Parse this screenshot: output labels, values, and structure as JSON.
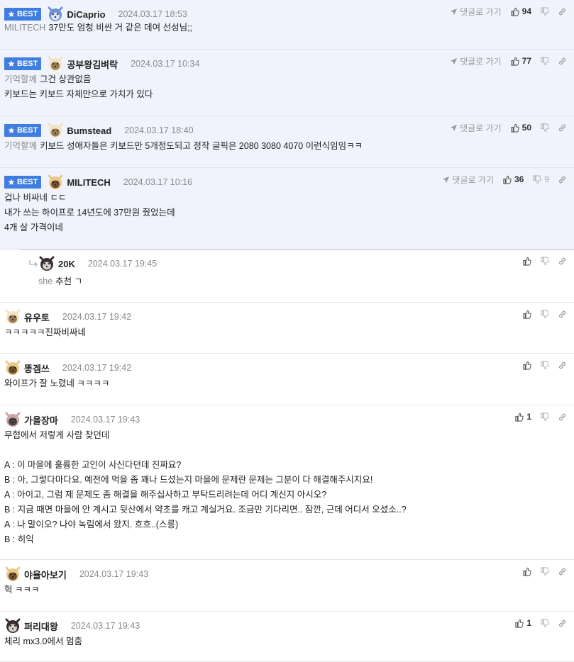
{
  "comments": [
    {
      "best": true,
      "badge": "BEST",
      "nick": "DiCaprio",
      "date": "2024.03.17 18:53",
      "reply_link": "댓글로 가기",
      "likes": "94",
      "dislikes": "",
      "lines": [
        {
          "ref": "MILITECH",
          "text": "37만도 엄청 비싼 거 같은 데여 선성님;;"
        }
      ]
    },
    {
      "best": true,
      "badge": "BEST",
      "nick": "공부왕김벼락",
      "date": "2024.03.17 10:34",
      "reply_link": "댓글로 가기",
      "likes": "77",
      "dislikes": "",
      "lines": [
        {
          "ref": "기억할께",
          "text": "그건 상관없음"
        },
        {
          "ref": "",
          "text": "키보드는 키보드 자체만으로 가치가 있다"
        }
      ]
    },
    {
      "best": true,
      "badge": "BEST",
      "nick": "Bumstead",
      "date": "2024.03.17 18:40",
      "reply_link": "댓글로 가기",
      "likes": "50",
      "dislikes": "",
      "lines": [
        {
          "ref": "기억할께",
          "text": "키보드 성애자들은 키보드만 5개정도되고 정작 글픽은 2080 3080 4070 이런식임임ㅋㅋ"
        }
      ]
    },
    {
      "best": true,
      "badge": "BEST",
      "nick": "MILITECH",
      "date": "2024.03.17 10:16",
      "reply_link": "댓글로 가기",
      "likes": "36",
      "dislikes": "9",
      "lines": [
        {
          "ref": "",
          "text": "겁나 비싸네 ㄷㄷ"
        },
        {
          "ref": "",
          "text": "내가 쓰는 하이프로 14년도에 37만원 줬었는데"
        },
        {
          "ref": "",
          "text": "4개 살 가격이네"
        }
      ]
    },
    {
      "best": false,
      "reply": true,
      "nick": "20K",
      "date": "2024.03.17 19:45",
      "likes": "",
      "dislikes": "",
      "lines": [
        {
          "ref": "she",
          "text": "추천 ㄱ"
        }
      ]
    },
    {
      "best": false,
      "nick": "유우토",
      "date": "2024.03.17 19:42",
      "likes": "",
      "dislikes": "",
      "lines": [
        {
          "ref": "",
          "text": "ㅋㅋㅋㅋㅋ진짜비싸네"
        }
      ]
    },
    {
      "best": false,
      "nick": "똥겜쓰",
      "date": "2024.03.17 19:42",
      "likes": "",
      "dislikes": "",
      "lines": [
        {
          "ref": "",
          "text": "와이프가 잘 노렸네 ㅋㅋㅋㅋ"
        }
      ]
    },
    {
      "best": false,
      "nick": "가을장마",
      "date": "2024.03.17 19:43",
      "likes": "1",
      "dislikes": "",
      "lines": [
        {
          "ref": "",
          "text": "무협에서 저렇게 사람 찾던데"
        },
        {
          "ref": "",
          "text": ""
        },
        {
          "ref": "",
          "text": "A : 이 마을에 훌륭한 고인이 사신다던데 진짜요?"
        },
        {
          "ref": "",
          "text": "B : 아, 그렇다마다요. 예전에 먹을 좀 꽤나 드셨는지 마을에 문제란 문제는 그분이 다 해결해주시지요!"
        },
        {
          "ref": "",
          "text": "A : 아이고, 그럼 제 문제도 좀 해결을 해주십사하고 부탁드리려는데 어디 계신지 아시오?"
        },
        {
          "ref": "",
          "text": "B : 지금 때면 마을에 안 계시고 뒷산에서 약초를 캐고 계실거요. 조금만 기다리면.. 잠깐, 근데 어디서 오셨소..?"
        },
        {
          "ref": "",
          "text": "A : 나 말이오? 나야 녹림에서 왔지. 흐흐..(스릉)"
        },
        {
          "ref": "",
          "text": "B : 히익"
        }
      ]
    },
    {
      "best": false,
      "nick": "야율아보기",
      "date": "2024.03.17 19:43",
      "likes": "",
      "dislikes": "",
      "lines": [
        {
          "ref": "",
          "text": "헉 ㅋㅋㅋ"
        }
      ]
    },
    {
      "best": false,
      "nick": "퍼리대왕",
      "date": "2024.03.17 19:43",
      "likes": "1",
      "dislikes": "",
      "lines": [
        {
          "ref": "",
          "text": "체리 mx3.0에서 멈춤"
        }
      ]
    }
  ],
  "colors": {
    "best_bg": "#f0f3fb",
    "badge": "#3f7de0",
    "divider": "#e3e6ea"
  },
  "icons": [
    "star-icon",
    "send-icon",
    "thumbs-up-icon",
    "thumbs-down-icon",
    "link-icon",
    "reply-arrow-icon",
    "avatar-icon"
  ]
}
